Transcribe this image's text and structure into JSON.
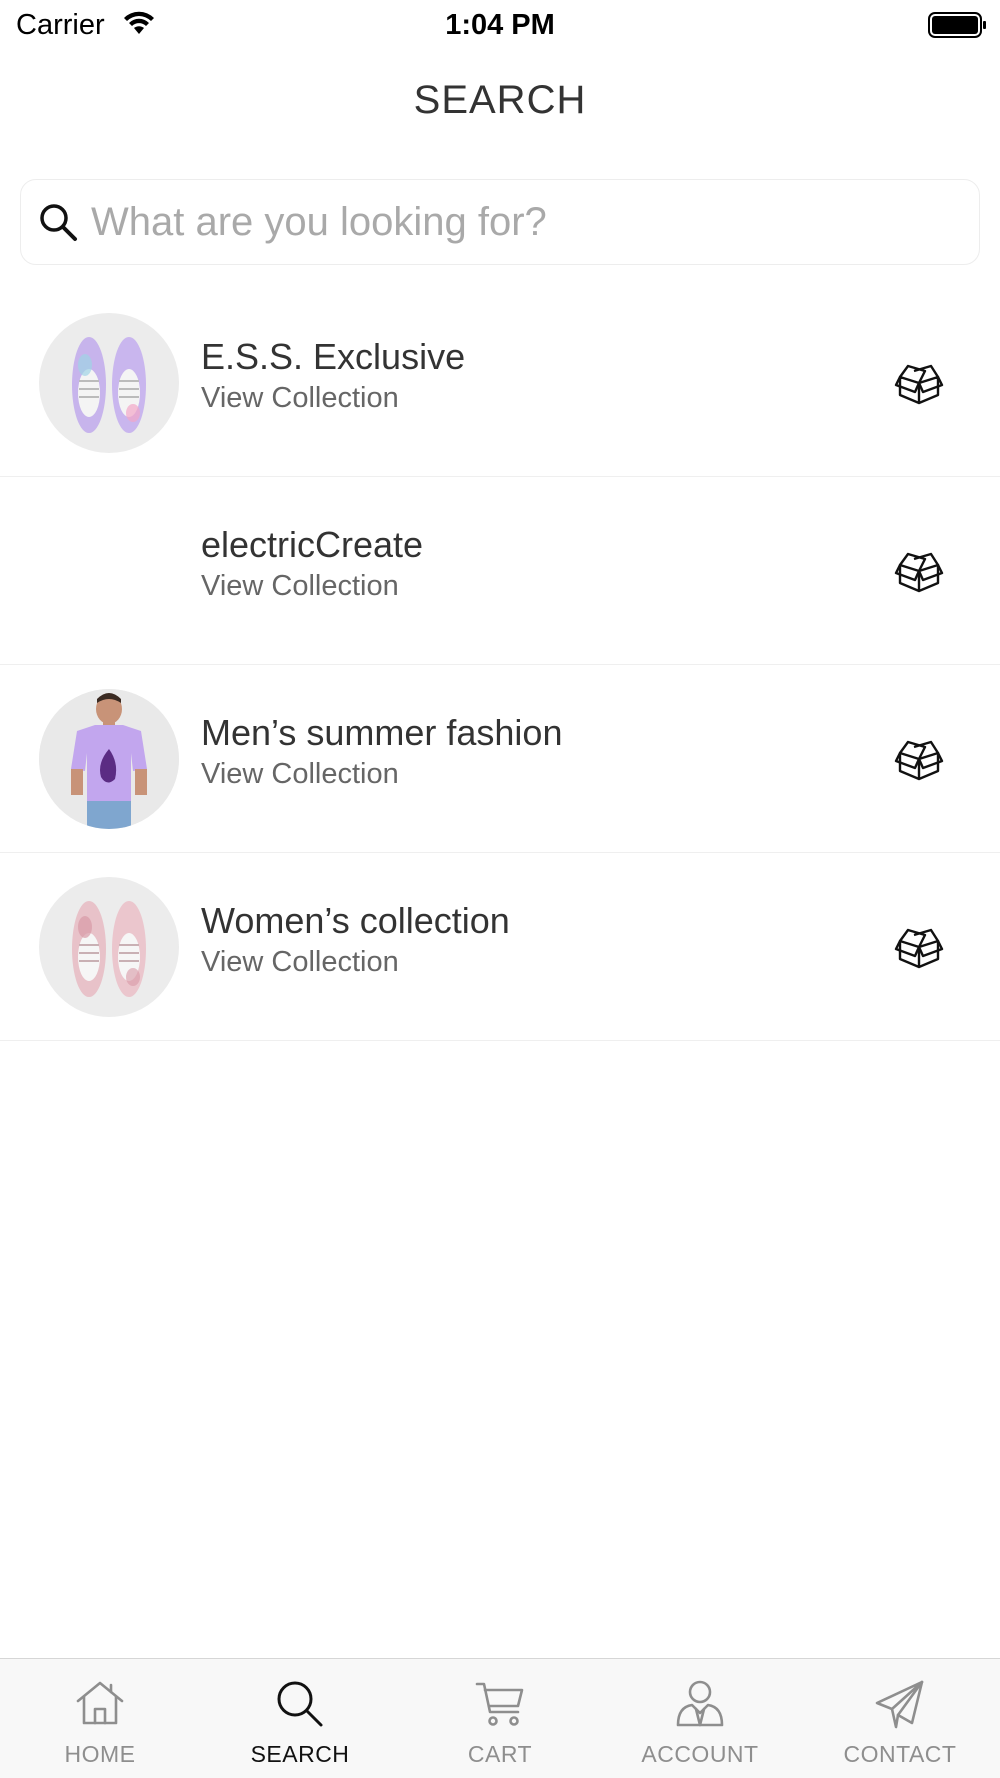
{
  "status_bar": {
    "carrier": "Carrier",
    "time": "1:04 PM"
  },
  "header": {
    "title": "SEARCH"
  },
  "search": {
    "placeholder": "What are you looking for?",
    "value": ""
  },
  "collections": [
    {
      "title": "E.S.S. Exclusive",
      "subtitle": "View Collection",
      "thumbnail": "lavender-sneakers-image"
    },
    {
      "title": "electricCreate",
      "subtitle": "View Collection",
      "thumbnail": ""
    },
    {
      "title": "Men’s summer fashion",
      "subtitle": "View Collection",
      "thumbnail": "man-in-lavender-tshirt-image"
    },
    {
      "title": "Women’s collection",
      "subtitle": "View Collection",
      "thumbnail": "pink-sneakers-image"
    }
  ],
  "tabs": [
    {
      "label": "HOME",
      "icon": "home-icon",
      "active": false
    },
    {
      "label": "SEARCH",
      "icon": "search-icon",
      "active": true
    },
    {
      "label": "CART",
      "icon": "cart-icon",
      "active": false
    },
    {
      "label": "ACCOUNT",
      "icon": "account-icon",
      "active": false
    },
    {
      "label": "CONTACT",
      "icon": "paper-plane-icon",
      "active": false
    }
  ],
  "colors": {
    "text": "#333333",
    "inactive_tab": "#8e8e8e",
    "active_tab": "#111111",
    "placeholder": "#a9a9a9"
  }
}
